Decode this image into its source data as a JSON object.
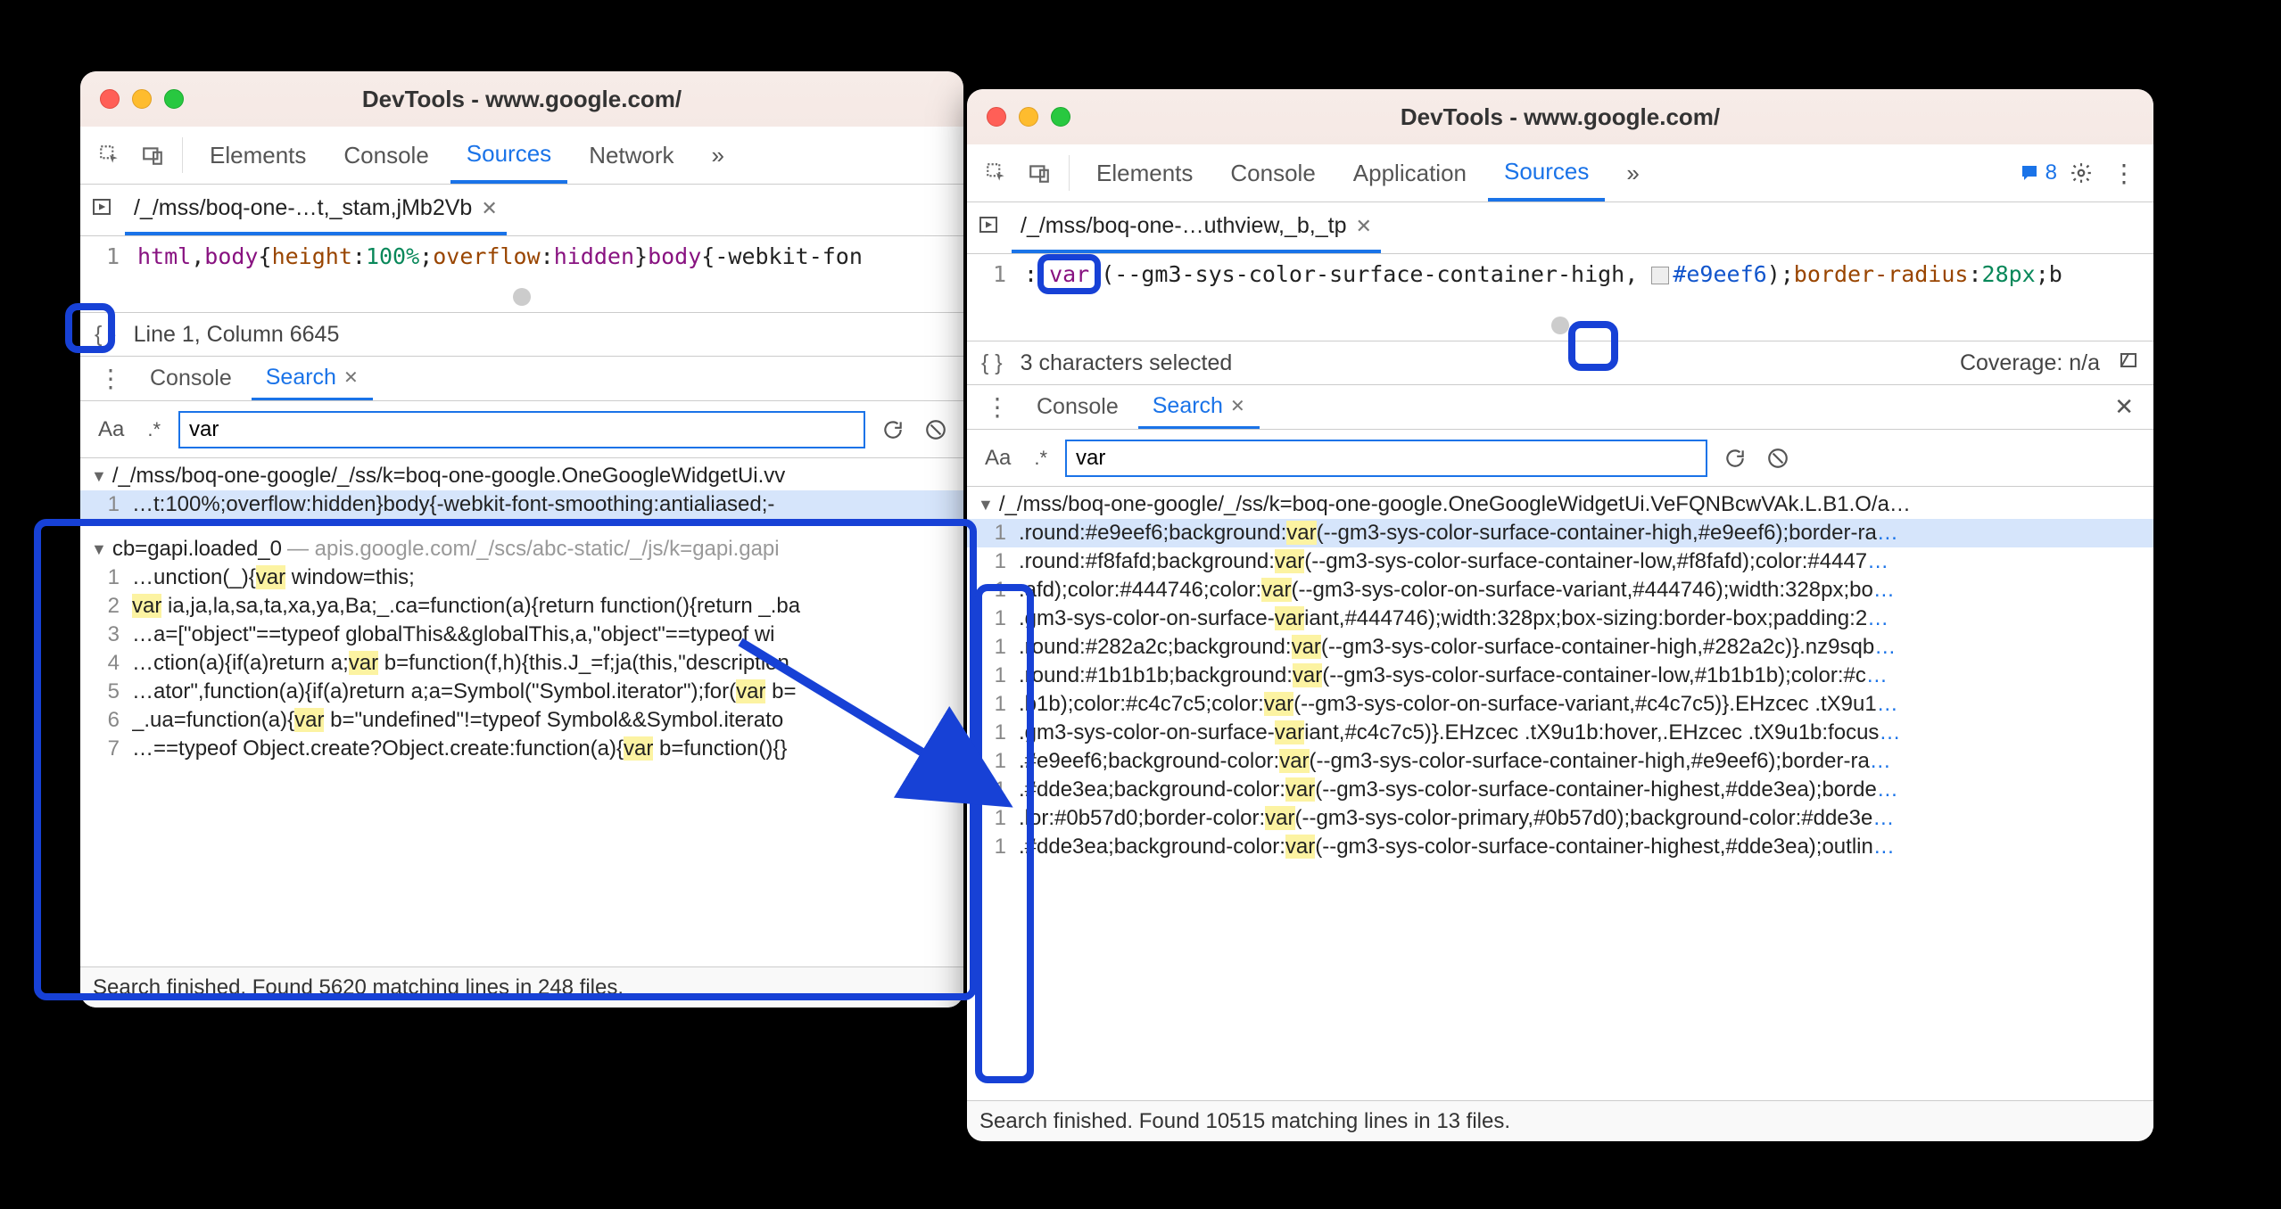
{
  "left": {
    "title": "DevTools - www.google.com/",
    "tabs": [
      "Elements",
      "Console",
      "Sources",
      "Network"
    ],
    "activeTab": 2,
    "moreTabs": "»",
    "fileTab": "/_/mss/boq-one-…t,_stam,jMb2Vb",
    "codeLine": 1,
    "code": {
      "seg1_tag": "html",
      "seg_comma": ",",
      "seg2_tag": "body",
      "seg_brace_open": "{",
      "seg3_prop": "height",
      "seg_colon": ":",
      "seg4_num": "100%",
      "seg_semicolon": ";",
      "seg5_prop": "overflow",
      "seg6_kw": "hidden",
      "seg_brace_close": "}",
      "seg7_tag": "body",
      "seg8": "{-webkit-fon"
    },
    "status": "Line 1, Column 6645",
    "drawerTabs": [
      "Console",
      "Search"
    ],
    "drawerActive": 1,
    "searchValue": "var",
    "results": {
      "group1": {
        "path": "/_/mss/boq-one-google/_/ss/k=boq-one-google.OneGoogleWidgetUi.vv",
        "lines": [
          {
            "n": 1,
            "pre": "…t:100%;overflow:hidden}body{-webkit-font-smoothing:antialiased;-",
            "hl": "",
            "post": "",
            "sel": true
          }
        ]
      },
      "group2": {
        "path": "cb=gapi.loaded_0",
        "suffix": " — apis.google.com/_/scs/abc-static/_/js/k=gapi.gapi",
        "lines": [
          {
            "n": 1,
            "pre": "…unction(_){",
            "hl": "var",
            "post": " window=this;"
          },
          {
            "n": 2,
            "pre": "",
            "hl": "var",
            "post": " ia,ja,la,sa,ta,xa,ya,Ba;_.ca=function(a){return function(){return _.ba"
          },
          {
            "n": 3,
            "pre": "…a=[\"object\"==typeof globalThis&&globalThis,a,\"object\"==typeof wi",
            "hl": "",
            "post": ""
          },
          {
            "n": 4,
            "pre": "…ction(a){if(a)return a;",
            "hl": "var",
            "post": " b=function(f,h){this.J_=f;ja(this,\"description"
          },
          {
            "n": 5,
            "pre": "…ator\",function(a){if(a)return a;a=Symbol(\"Symbol.iterator\");for(",
            "hl": "var",
            "post": " b="
          },
          {
            "n": 6,
            "pre": "_.ua=function(a){",
            "hl": "var",
            "post": " b=\"undefined\"!=typeof Symbol&&Symbol.iterato"
          },
          {
            "n": 7,
            "pre": "…==typeof Object.create?Object.create:function(a){",
            "hl": "var",
            "post": " b=function(){}"
          }
        ]
      }
    },
    "footer": "Search finished.  Found 5620 matching lines in 248 files."
  },
  "right": {
    "title": "DevTools - www.google.com/",
    "tabs": [
      "Elements",
      "Console",
      "Application",
      "Sources"
    ],
    "activeTab": 3,
    "moreTabs": "»",
    "msgCount": "8",
    "fileTab": "/_/mss/boq-one-…uthview,_b,_tp",
    "codeLine": 1,
    "code": {
      "pre": ":",
      "var": "var",
      "mid": "(--gm3-sys-color-surface-container-high, ",
      "hex": "#e9eef6",
      "post1": ");",
      "prop": "border-radius",
      "post2": ":",
      "num": "28px",
      "post3": ";b"
    },
    "status_left": "3 characters selected",
    "status_right": "Coverage: n/a",
    "drawerTabs": [
      "Console",
      "Search"
    ],
    "drawerActive": 1,
    "searchValue": "var",
    "group": {
      "path": "/_/mss/boq-one-google/_/ss/k=boq-one-google.OneGoogleWidgetUi.VeFQNBcwVAk.L.B1.O/a…"
    },
    "lines": [
      {
        "n": 1,
        "pre": ".round:#e9eef6;background:",
        "hl": "var",
        "post": "(--gm3-sys-color-surface-container-high,#e9eef6);border-ra",
        "sel": true,
        "trail": true
      },
      {
        "n": 1,
        "pre": ".round:#f8fafd;background:",
        "hl": "var",
        "post": "(--gm3-sys-color-surface-container-low,#f8fafd);color:#4447",
        "trail": true
      },
      {
        "n": 1,
        "pre": ".afd);color:#444746;color:",
        "hl": "var",
        "post": "(--gm3-sys-color-on-surface-variant,#444746);width:328px;bo",
        "trail": true
      },
      {
        "n": 1,
        "pre": ".gm3-sys-color-on-surface-",
        "hl": "var",
        "post": "iant,#444746);width:328px;box-sizing:border-box;padding:2",
        "trail": true
      },
      {
        "n": 1,
        "pre": ".round:#282a2c;background:",
        "hl": "var",
        "post": "(--gm3-sys-color-surface-container-high,#282a2c)}.nz9sqb",
        "trail": true
      },
      {
        "n": 1,
        "pre": ".round:#1b1b1b;background:",
        "hl": "var",
        "post": "(--gm3-sys-color-surface-container-low,#1b1b1b);color:#c",
        "trail": true
      },
      {
        "n": 1,
        "pre": ".b1b);color:#c4c7c5;color:",
        "hl": "var",
        "post": "(--gm3-sys-color-on-surface-variant,#c4c7c5)}.EHzcec .tX9u1",
        "trail": true
      },
      {
        "n": 1,
        "pre": ".gm3-sys-color-on-surface-",
        "hl": "var",
        "post": "iant,#c4c7c5)}.EHzcec .tX9u1b:hover,.EHzcec .tX9u1b:focus",
        "trail": true
      },
      {
        "n": 1,
        "pre": ".#e9eef6;background-color:",
        "hl": "var",
        "post": "(--gm3-sys-color-surface-container-high,#e9eef6);border-ra",
        "trail": true
      },
      {
        "n": 1,
        "pre": ".#dde3ea;background-color:",
        "hl": "var",
        "post": "(--gm3-sys-color-surface-container-highest,#dde3ea);borde",
        "trail": true
      },
      {
        "n": 1,
        "pre": ".lor:#0b57d0;border-color:",
        "hl": "var",
        "post": "(--gm3-sys-color-primary,#0b57d0);background-color:#dde3e",
        "trail": true
      },
      {
        "n": 1,
        "pre": ".#dde3ea;background-color:",
        "hl": "var",
        "post": "(--gm3-sys-color-surface-container-highest,#dde3ea);outlin",
        "trail": true
      }
    ],
    "footer": "Search finished.  Found 10515 matching lines in 13 files."
  }
}
